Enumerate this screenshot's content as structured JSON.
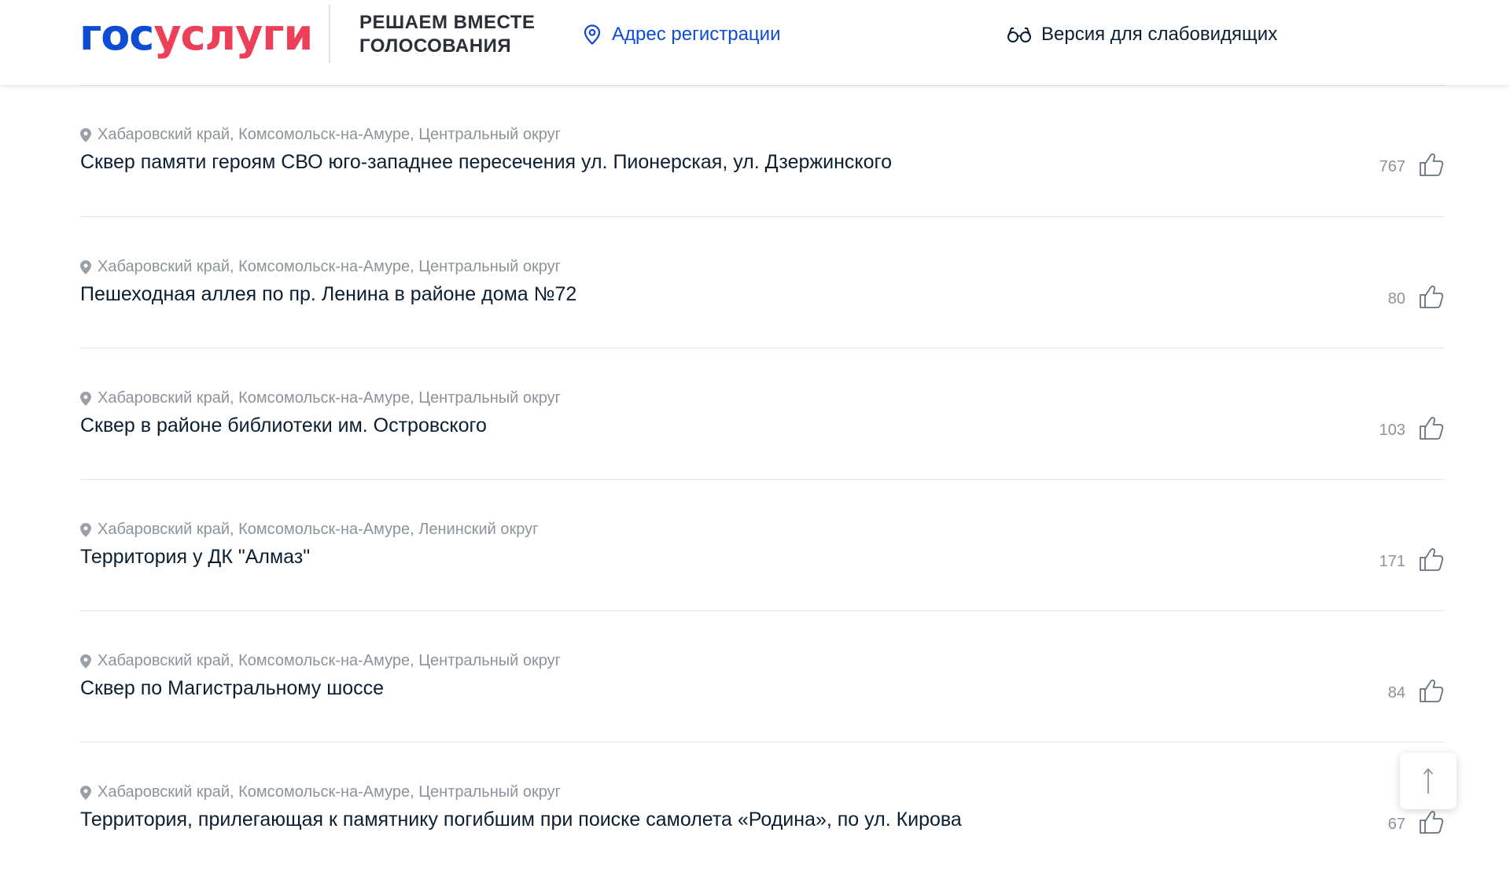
{
  "header": {
    "logo_part1": "гос",
    "logo_part2": "услуги",
    "tagline_line1": "РЕШАЕМ ВМЕСТЕ",
    "tagline_line2": "ГОЛОСОВАНИЯ",
    "address_link": "Адрес регистрации",
    "low_vision_link": "Версия для слабовидящих"
  },
  "colors": {
    "brand_blue": "#0d4cd3",
    "brand_red": "#ee3f58",
    "muted_text": "#8d939c"
  },
  "items": [
    {
      "location": "Хабаровский край, Комсомольск-на-Амуре, Центральный округ",
      "title": "Сквер памяти героям СВО юго-западнее пересечения ул. Пионерская, ул. Дзержинского",
      "likes": "767"
    },
    {
      "location": "Хабаровский край, Комсомольск-на-Амуре, Центральный округ",
      "title": "Пешеходная аллея по пр. Ленина в районе дома №72",
      "likes": "80"
    },
    {
      "location": "Хабаровский край, Комсомольск-на-Амуре, Центральный округ",
      "title": "Сквер в районе библиотеки им. Островского",
      "likes": "103"
    },
    {
      "location": "Хабаровский край, Комсомольск-на-Амуре, Ленинский округ",
      "title": "Территория у ДК \"Алмаз\"",
      "likes": "171"
    },
    {
      "location": "Хабаровский край, Комсомольск-на-Амуре, Центральный округ",
      "title": "Сквер по Магистральному шоссе",
      "likes": "84"
    },
    {
      "location": "Хабаровский край, Комсомольск-на-Амуре, Центральный округ",
      "title": "Территория, прилегающая к памятнику погибшим при поиске самолета «Родина», по ул. Кирова",
      "likes": "67"
    }
  ],
  "icons": {
    "location": "location-pin-icon",
    "like": "thumbs-up-icon",
    "glasses": "glasses-icon",
    "scroll_top": "arrow-up-icon"
  }
}
